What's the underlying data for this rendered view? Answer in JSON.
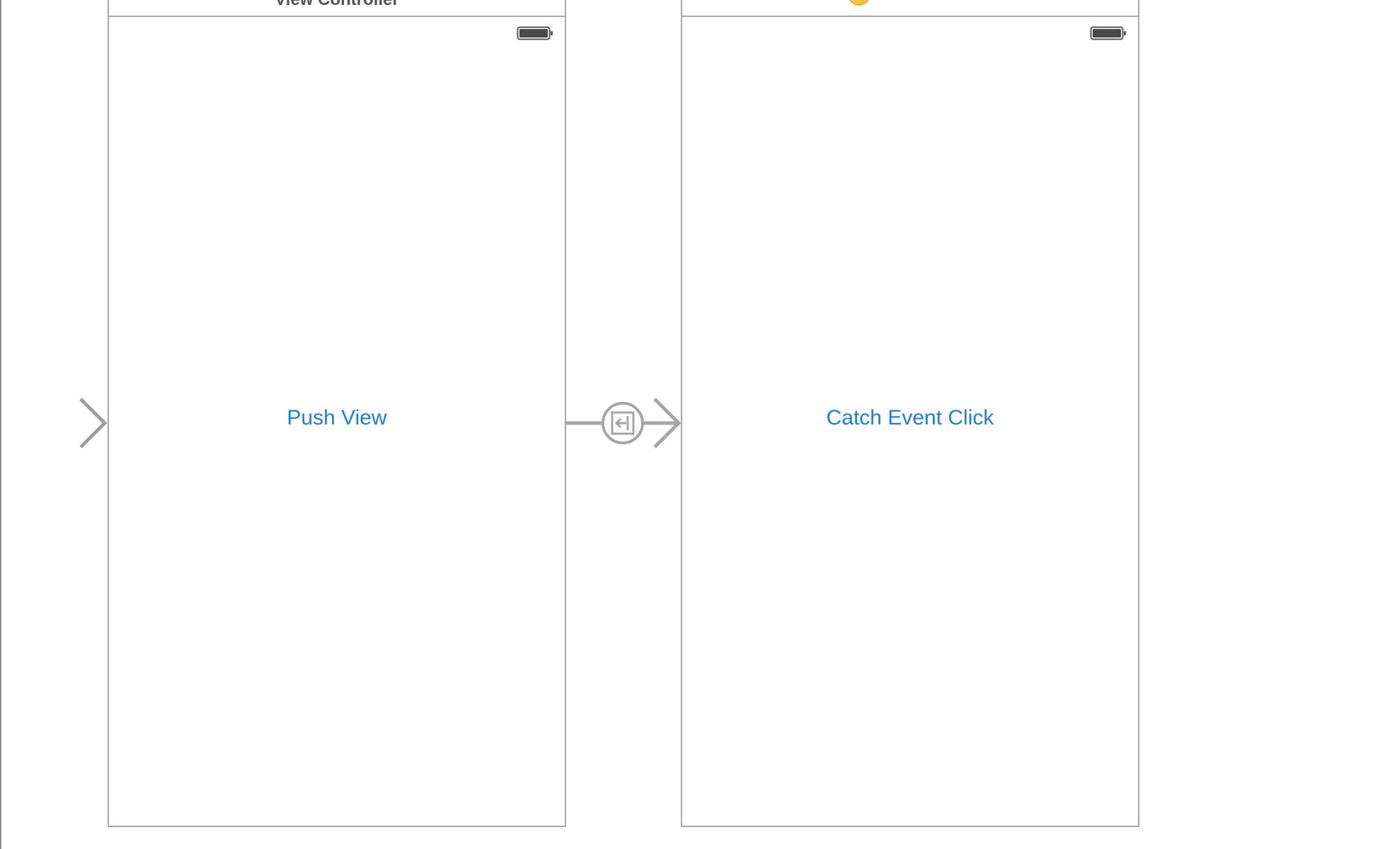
{
  "storyboard": {
    "scene_one": {
      "header_title": "View Controller",
      "button_label": "Push View"
    },
    "scene_two": {
      "dock_icons": [
        "view-controller-icon",
        "first-responder-icon",
        "exit-icon"
      ],
      "button_label": "Catch Event Click"
    },
    "entry_point": "initial-view-controller-arrow-icon",
    "segue": "push-segue-icon"
  },
  "colors": {
    "button_text": "#1a7ee8",
    "frame_border": "#a9a9a9",
    "arrow": "#9e9e9e",
    "dock_view_controller": "#f5c242",
    "dock_first_responder": "#f07843",
    "dock_exit": "#f07843"
  }
}
